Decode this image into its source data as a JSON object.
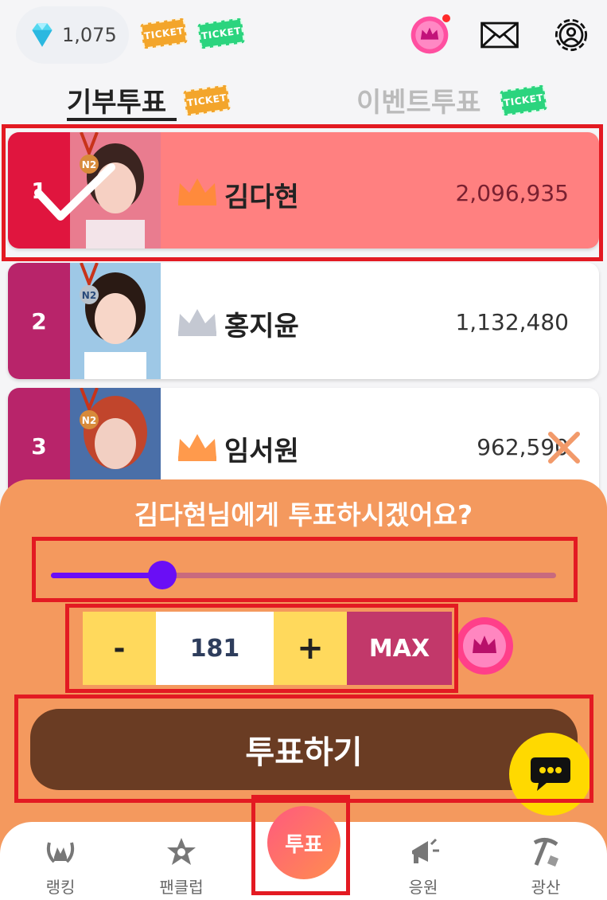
{
  "header": {
    "gem_count": "1,075",
    "ticket_label": "TICKET"
  },
  "tabs": [
    {
      "label": "기부투표",
      "active": true
    },
    {
      "label": "이벤트투표",
      "active": false
    }
  ],
  "ranking": [
    {
      "rank": "1",
      "name": "김다현",
      "votes": "2,096,935",
      "badge": "N2",
      "selected": true
    },
    {
      "rank": "2",
      "name": "홍지윤",
      "votes": "1,132,480",
      "badge": "N2",
      "selected": false
    },
    {
      "rank": "3",
      "name": "임서원",
      "votes": "962,590",
      "badge": "N2",
      "selected": false
    }
  ],
  "vote_sheet": {
    "title": "김다현님에게 투표하시겠어요?",
    "slider_value_fraction": 0.22,
    "minus_label": "-",
    "quantity": "181",
    "plus_label": "+",
    "max_label": "MAX",
    "vote_button_label": "투표하기"
  },
  "bottom_nav": [
    {
      "label": "랭킹",
      "icon": "laurel-icon"
    },
    {
      "label": "팬클럽",
      "icon": "star-badge-icon"
    },
    {
      "label": "투표",
      "icon": "vote-fab"
    },
    {
      "label": "응원",
      "icon": "megaphone-icon"
    },
    {
      "label": "광산",
      "icon": "pickaxe-icon"
    }
  ],
  "colors": {
    "accent_purple": "#6a0ef5",
    "sheet_orange": "#f4995e",
    "max_pink": "#c2386a",
    "vote_brown": "#6a3c23",
    "highlight_red": "#e31a22"
  }
}
